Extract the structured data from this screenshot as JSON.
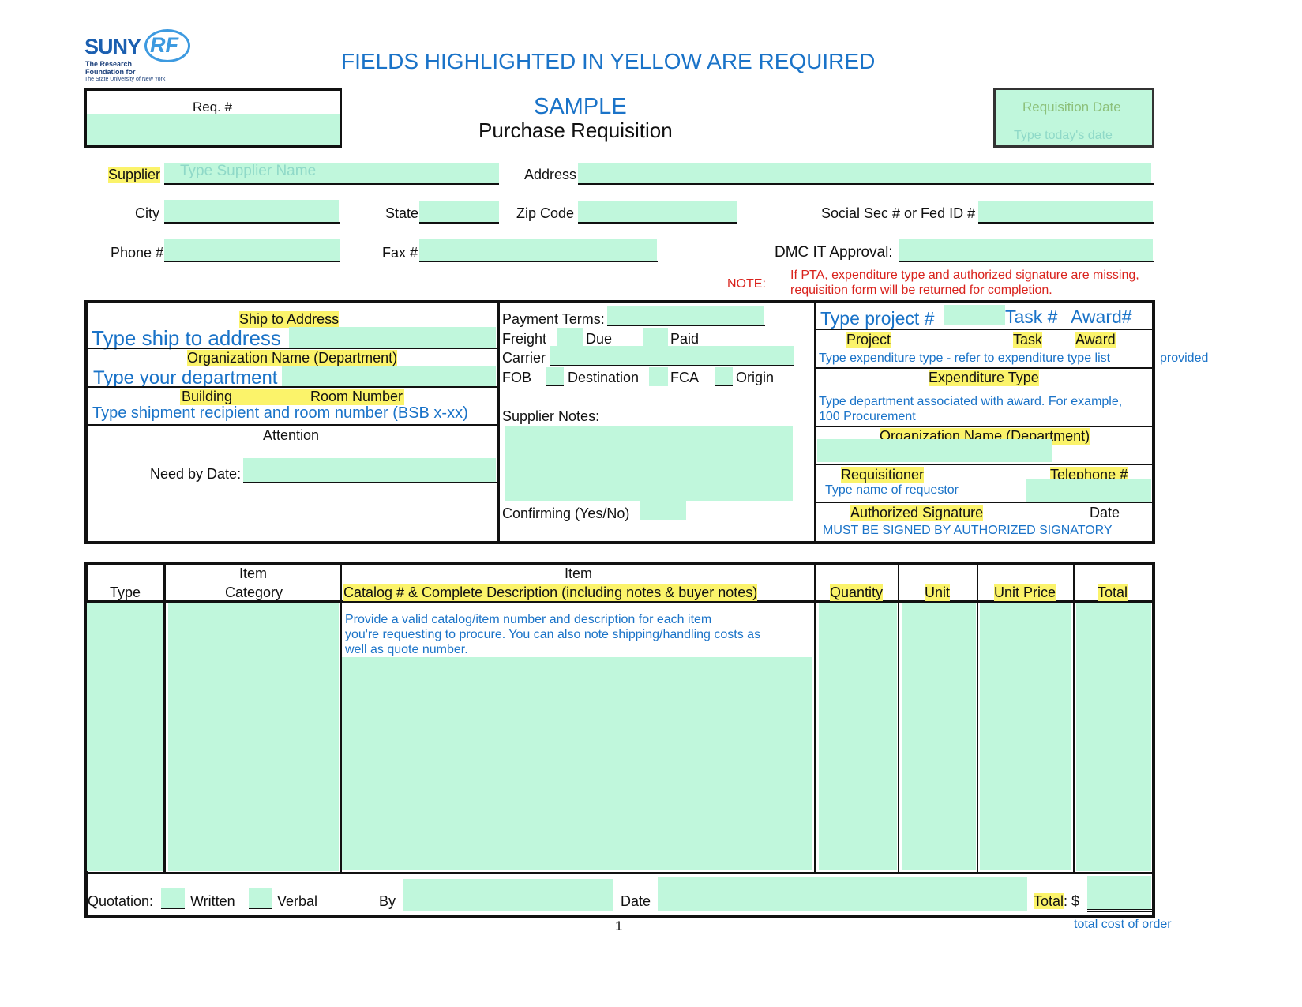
{
  "logo": {
    "suny": "SUNY",
    "rf": "RF",
    "line1": "The Research",
    "line2": "Foundation for",
    "line3": "The State University of New York"
  },
  "banner": "FIELDS HIGHLIGHTED IN YELLOW ARE REQUIRED",
  "req_label": "Req. #",
  "title_sample": "SAMPLE",
  "title_main": "Purchase Requisition",
  "req_date": {
    "label": "Requisition Date",
    "placeholder": "Type today's date"
  },
  "supplier": {
    "label": "Supplier",
    "placeholder": "Type Supplier Name",
    "address": "Address",
    "city": "City",
    "state": "State",
    "zip": "Zip Code",
    "ssn": "Social Sec # or Fed ID #",
    "phone": "Phone #",
    "fax": "Fax #",
    "dmc": "DMC IT Approval:"
  },
  "note": {
    "label": "NOTE:",
    "line1": "If PTA, expenditure type and authorized signature are missing,",
    "line2": "requisition form will be returned for completion."
  },
  "ship": {
    "ship_label": "Ship to Address",
    "ship_placeholder": "Type ship to address",
    "org_label": "Organization Name (Department)",
    "org_placeholder": "Type your department",
    "building": "Building",
    "room": "Room Number",
    "recipient_placeholder": "Type shipment recipient and room number (BSB x-xx)",
    "attention": "Attention",
    "need_by": "Need by Date:"
  },
  "payment": {
    "terms": "Payment Terms:",
    "freight": "Freight",
    "due": "Due",
    "paid": "Paid",
    "carrier": "Carrier",
    "fob": "FOB",
    "destination": "Destination",
    "fca": "FCA",
    "origin": "Origin",
    "supplier_notes": "Supplier Notes:",
    "confirming": "Confirming (Yes/No)"
  },
  "pta": {
    "project_placeholder": "Type project #",
    "task_placeholder": "Task #",
    "award_placeholder": "Award#",
    "project": "Project",
    "task": "Task",
    "award": "Award",
    "exp_type_hint": "Type expenditure type - refer to expenditure type list",
    "provided": "provided",
    "exp_type_label": "Expenditure Type",
    "dept_hint_1": "Type department associated with award. For example,",
    "dept_hint_2": "100 Procurement",
    "org_label": "Organization Name (Department)",
    "requisitioner": "Requisitioner",
    "telephone": "Telephone #",
    "requestor_placeholder": "Type name of requestor",
    "auth_sig": "Authorized Signature",
    "date": "Date",
    "must_sign": "MUST BE SIGNED BY AUTHORIZED SIGNATORY"
  },
  "items": {
    "col_type": "Type",
    "col_cat_1": "Item",
    "col_cat_2": "Category",
    "col_desc_1": "Item",
    "col_desc_2": "Catalog # & Complete Description (including notes & buyer notes)",
    "col_qty": "Quantity",
    "col_unit": "Unit",
    "col_price": "Unit Price",
    "col_total": "Total",
    "desc_hint_1": "Provide a valid catalog/item number and description for each item",
    "desc_hint_2": "you're requesting to procure. You can also note shipping/handling costs as",
    "desc_hint_3": "well as quote number."
  },
  "footer": {
    "quotation": "Quotation:",
    "written": "Written",
    "verbal": "Verbal",
    "by": "By",
    "date": "Date",
    "total": "Total",
    "colon_dollar": ": $",
    "total_note": "total cost of order",
    "page": "1"
  }
}
